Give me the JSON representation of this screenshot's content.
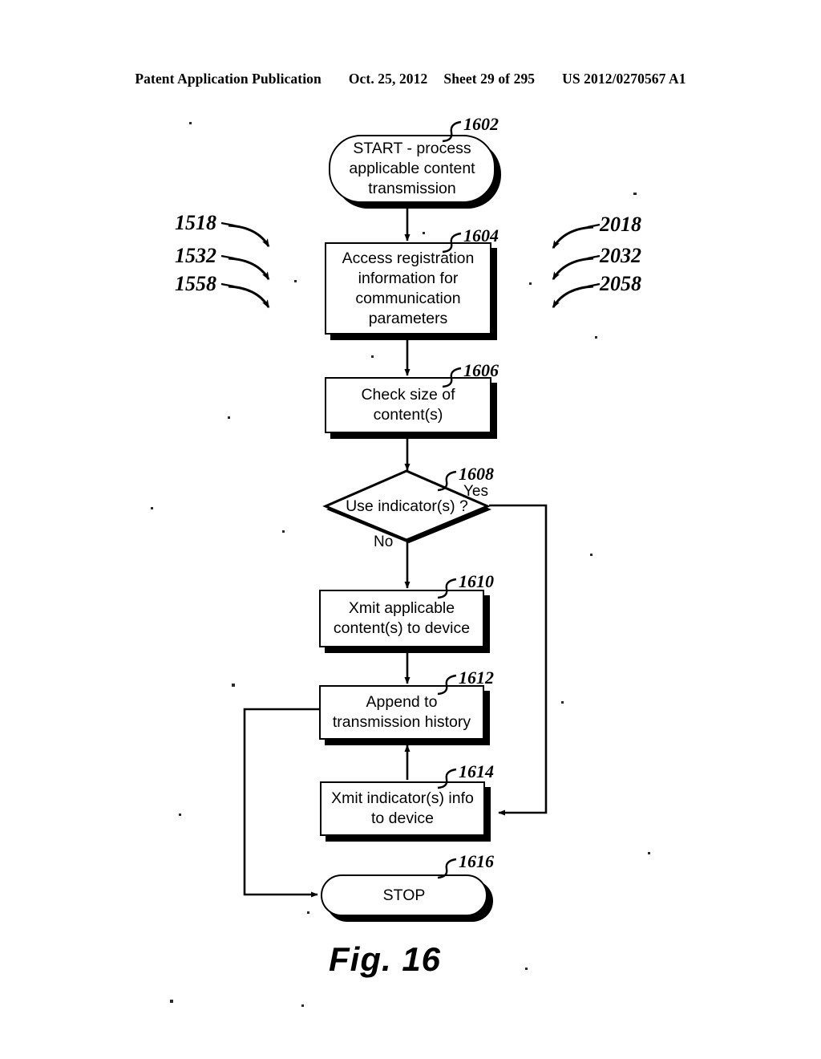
{
  "header": {
    "publication": "Patent Application Publication",
    "date": "Oct. 25, 2012",
    "sheet": "Sheet 29 of 295",
    "patent_number": "US 2012/0270567 A1"
  },
  "figure": {
    "caption": "Fig. 16"
  },
  "nodes": {
    "start": {
      "ref": "1602",
      "text": "START - process applicable content transmission",
      "type": "terminal"
    },
    "access": {
      "ref": "1604",
      "text": "Access registration information for communication parameters",
      "type": "process"
    },
    "check": {
      "ref": "1606",
      "text": "Check size of content(s)",
      "type": "process"
    },
    "decision": {
      "ref": "1608",
      "text": "Use indicator(s) ?",
      "type": "decision"
    },
    "xmit_content": {
      "ref": "1610",
      "text": "Xmit applicable content(s) to device",
      "type": "process"
    },
    "append": {
      "ref": "1612",
      "text": "Append to transmission history",
      "type": "process"
    },
    "xmit_indicator": {
      "ref": "1614",
      "text": "Xmit indicator(s) info to device",
      "type": "process"
    },
    "stop": {
      "ref": "1616",
      "text": "STOP",
      "type": "terminal"
    }
  },
  "branch_labels": {
    "yes": "Yes",
    "no": "No"
  },
  "left_refs": [
    "1518",
    "1532",
    "1558"
  ],
  "right_refs": [
    "2018",
    "2032",
    "2058"
  ],
  "colors": {
    "ink": "#000000",
    "paper": "#ffffff"
  }
}
